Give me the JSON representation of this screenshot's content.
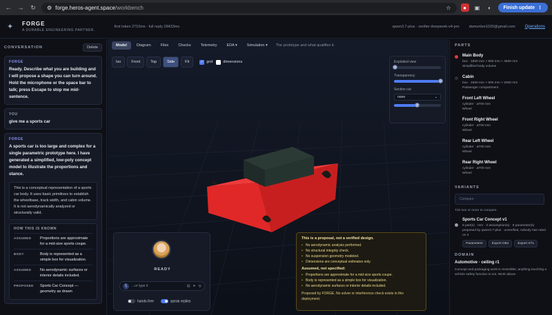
{
  "browser": {
    "url_host": "forge.heros-agent.space",
    "url_path": "/workbench",
    "finish_label": "Finish update"
  },
  "header": {
    "brand": "FORGE",
    "tagline": "A DURABLE ENGINEERING PARTNER.",
    "tokens": "first token 2710ms · full reply 28433ms",
    "model": "qwen3.7-plus · verifier deepseek-v4-pro",
    "email": "damonlee1020@gmail.com",
    "operations": "Operations"
  },
  "conversation": {
    "title": "CONVERSATION",
    "delete_label": "Delete",
    "messages": [
      {
        "who": "FORGE",
        "text": "Ready. Describe what you are building and I will propose a shape you can turn around. Hold the microphone or the space bar to talk; press Escape to stop me mid-sentence."
      },
      {
        "who": "YOU",
        "text": "give me a sports car"
      },
      {
        "who": "FORGE",
        "text": "A sports car is too large and complex for a single parametric prototype here. I have generated a simplified, low-poly concept model to illustrate the proportions and stance."
      }
    ],
    "note": "This is a conceptual representation of a sports car body. It uses basic primitives to establish the wheelbase, track width, and cabin volume. It is not aerodynamically analyzed or structurally valid.",
    "known_title": "HOW THIS IS KNOWN",
    "known": [
      {
        "k": "ASSUMED",
        "v": "Proportions are approximate for a mid-size sports coupe."
      },
      {
        "k": "BODY",
        "v": "Body is represented as a simple box for visualization."
      },
      {
        "k": "ASSUMED",
        "v": "No aerodynamic surfaces or interior details included."
      },
      {
        "k": "PROPOSED",
        "v": "Sports Car Concept — geometry as drawn"
      }
    ]
  },
  "workbench": {
    "tabs": [
      "Model",
      "Diagram",
      "Files",
      "Checks",
      "Telemetry",
      "EDA ▾",
      "Simulation ▾"
    ],
    "tab_hint": "The prototype and what qualifies it.",
    "views": [
      "Iso",
      "Front",
      "Top",
      "Side",
      "Fit"
    ],
    "grid_label": "grid",
    "dimensions_label": "dimensions",
    "exploded_label": "Exploded view",
    "transparency_label": "Transparency",
    "section_label": "Section cut",
    "section_value": "none",
    "exploded_value": 0.02,
    "transparency_value": 1.0,
    "section_slider_value": 0.5
  },
  "voice": {
    "status": "READY",
    "placeholder": "...or type it",
    "hands_free": "hands-free",
    "speak_replies": "speak replies"
  },
  "notice": {
    "title": "This is a proposal, not a verified design.",
    "items": [
      "No aerodynamic analysis performed.",
      "No structural integrity check.",
      "No suspension geometry modeled.",
      "Dimensions are conceptual estimates only."
    ],
    "sub": "Assumed, not specified:",
    "assumed": [
      "Proportions are approximate for a mid-size sports coupe.",
      "Body is represented as a simple box for visualization.",
      "No aerodynamic surfaces or interior details included."
    ],
    "foot": "Proposed by FORGE. No solver or interference check exists in this deployment."
  },
  "parts": {
    "title": "PARTS",
    "items": [
      {
        "name": "Main Body",
        "dim": "box · 1800 mm × 800 mm × 4500 mm",
        "desc": "Simplified body volume",
        "color": "#e23b3b"
      },
      {
        "name": "Cabin",
        "dim": "box · 1600 mm × 500 mm × 2000 mm",
        "desc": "Passenger compartment",
        "color": "#2b2f36"
      },
      {
        "name": "Front Left Wheel",
        "dim": "cylinder · ⌀700 mm",
        "desc": "Wheel",
        "color": ""
      },
      {
        "name": "Front Right Wheel",
        "dim": "cylinder · ⌀700 mm",
        "desc": "Wheel",
        "color": ""
      },
      {
        "name": "Rear Left Wheel",
        "dim": "cylinder · ⌀700 mm",
        "desc": "Wheel",
        "color": ""
      },
      {
        "name": "Rear Right Wheel",
        "dim": "cylinder · ⌀700 mm",
        "desc": "Wheel",
        "color": ""
      }
    ]
  },
  "variants": {
    "title": "VARIANTS",
    "compare_label": "Compare",
    "hint": "Tick two or more to compare.",
    "item": {
      "name": "Sports Car Concept v1",
      "desc": "6 part(s) · mm · 3 assumption(s) · 8 parameter(s) proposed by qwen3.7-plus · unverified, nobody has ruled on it",
      "buttons": [
        "Parameters",
        "Export OBJ",
        "Export STL"
      ]
    }
  },
  "domain": {
    "title": "DOMAIN",
    "name": "Automotive · ceiling r1",
    "desc": "Concept and packaging work is reversible; anything touching a vehicle safety function is not. Work above"
  }
}
